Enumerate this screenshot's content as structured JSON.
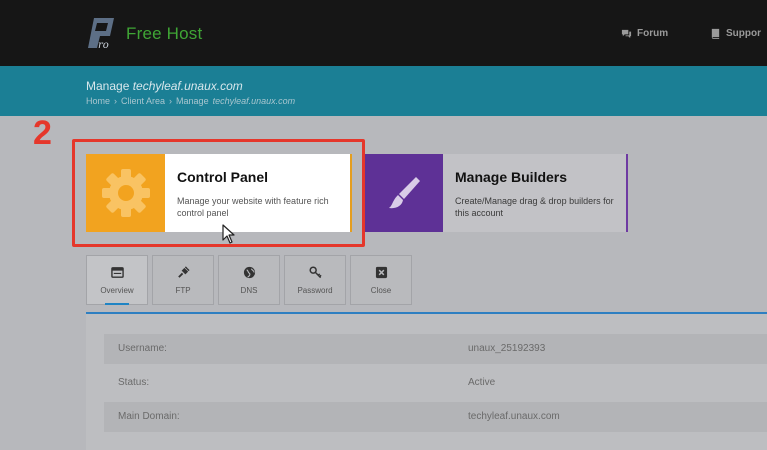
{
  "header": {
    "brand": "Free Host",
    "nav": [
      {
        "label": "Forum",
        "icon": "chat-icon"
      },
      {
        "label": "Suppor",
        "icon": "book-icon"
      }
    ]
  },
  "banner": {
    "title_prefix": "Manage",
    "title_domain": "techyleaf.unaux.com",
    "breadcrumb": {
      "home": "Home",
      "client_area": "Client Area",
      "current_prefix": "Manage",
      "current_domain": "techyleaf.unaux.com"
    }
  },
  "step_number": "2",
  "cards": {
    "control_panel": {
      "title": "Control Panel",
      "desc": "Manage your website with feature rich control panel",
      "icon": "gear-icon",
      "color": "#f2a31f"
    },
    "builders": {
      "title": "Manage Builders",
      "desc": "Create/Manage drag & drop builders for this account",
      "icon": "paintbrush-icon",
      "color": "#5e3196"
    }
  },
  "tabs": [
    {
      "label": "Overview",
      "icon": "window-icon"
    },
    {
      "label": "FTP",
      "icon": "plug-icon"
    },
    {
      "label": "DNS",
      "icon": "globe-icon"
    },
    {
      "label": "Password",
      "icon": "key-icon"
    },
    {
      "label": "Close",
      "icon": "close-icon"
    }
  ],
  "info": {
    "rows": [
      {
        "key": "Username:",
        "value": "unaux_25192393"
      },
      {
        "key": "Status:",
        "value": "Active"
      },
      {
        "key": "Main Domain:",
        "value": "techyleaf.unaux.com"
      }
    ]
  }
}
